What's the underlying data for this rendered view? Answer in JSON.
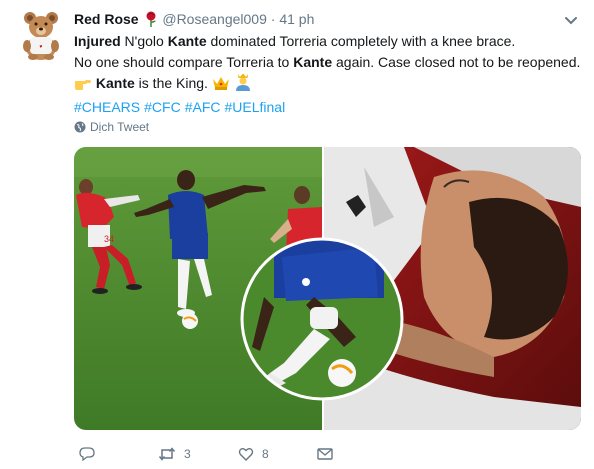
{
  "user": {
    "name": "Red Rose",
    "handle": "@Roseangel009",
    "separator": "·",
    "time": "41 ph"
  },
  "tweet": {
    "line1": {
      "bold1": "Injured",
      "text1": " N'golo ",
      "bold2": "Kante",
      "text2": " dominated Torreria completely with a knee brace."
    },
    "line2": {
      "text1": "No one should compare Torreria to ",
      "bold1": "Kante",
      "text2": " again. Case closed not to be reopened."
    },
    "line3": {
      "bold1": "Kante",
      "text1": " is the King. "
    },
    "hashtags": [
      "#CHEARS",
      "#CFC",
      "#AFC",
      "#UELfinal"
    ]
  },
  "translate_label": "Dịch Tweet",
  "stats": {
    "retweets": "3",
    "likes": "8"
  },
  "icons": {
    "avatar": "teddy-bear-avatar",
    "rose": "rose-icon",
    "caret": "chevron-down-icon",
    "translate": "globe-icon",
    "point": "backhand-pointing-right-icon",
    "crown": "crown-icon",
    "king": "person-with-crown-icon",
    "reply": "reply-icon",
    "retweet": "retweet-icon",
    "like": "heart-icon",
    "message": "envelope-icon"
  },
  "colors": {
    "link": "#1da1f2",
    "muted": "#657786",
    "text": "#14171a",
    "chelsea_blue": "#1b3f9e",
    "arsenal_red": "#d21e2a",
    "pitch_green": "#4f8f2e"
  }
}
